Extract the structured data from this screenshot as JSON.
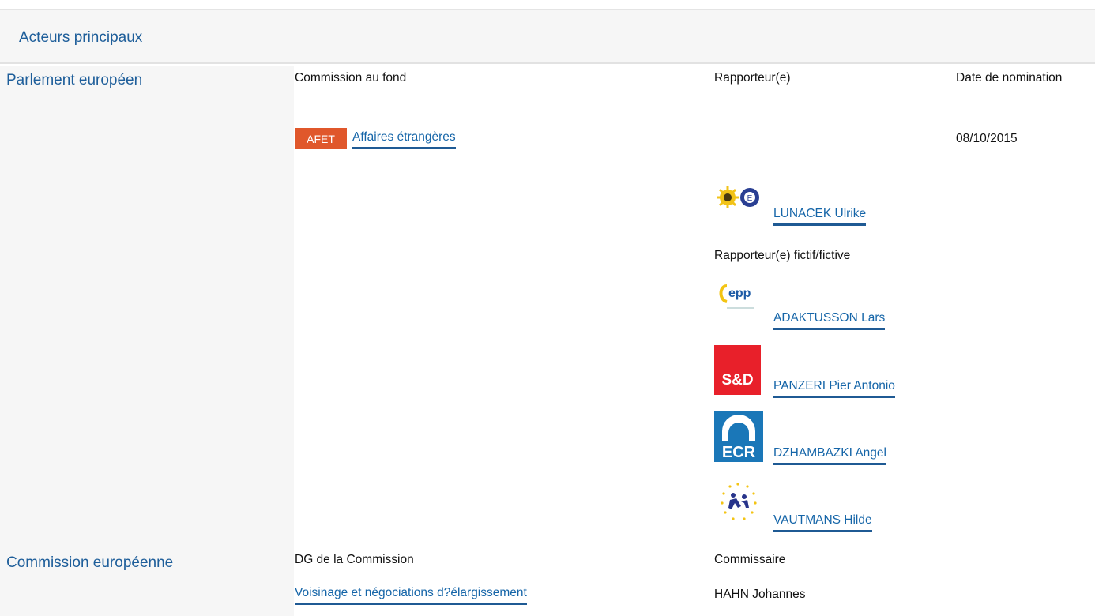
{
  "header": {
    "title": "Acteurs principaux"
  },
  "parliament": {
    "title": "Parlement européen",
    "col_committee": "Commission au fond",
    "col_rapporteur": "Rapporteur(e)",
    "col_date": "Date de nomination",
    "committee_badge": "AFET",
    "committee_link": "Affaires étrangères",
    "date": "08/10/2015",
    "rapporteur": {
      "name": "LUNACEK Ulrike",
      "group_logo": "greens-efa-logo"
    },
    "shadow_label": "Rapporteur(e) fictif/fictive",
    "shadows": [
      {
        "name": "ADAKTUSSON Lars",
        "group_logo": "epp-logo",
        "logo_text": "epp"
      },
      {
        "name": "PANZERI Pier Antonio",
        "group_logo": "sd-logo",
        "logo_text": "S&D"
      },
      {
        "name": "DZHAMBAZKI Angel",
        "group_logo": "ecr-logo",
        "logo_text": "ECR"
      },
      {
        "name": "VAUTMANS Hilde",
        "group_logo": "alde-logo"
      }
    ]
  },
  "commission": {
    "title": "Commission européenne",
    "col_dg": "DG de la Commission",
    "col_commissioner": "Commissaire",
    "dg_link": "Voisinage et négociations d?élargissement",
    "commissioner": "HAHN Johannes"
  },
  "colors": {
    "accent": "#1e5e9a",
    "badge": "#e0572b",
    "link_underline": "#1f5a94"
  }
}
